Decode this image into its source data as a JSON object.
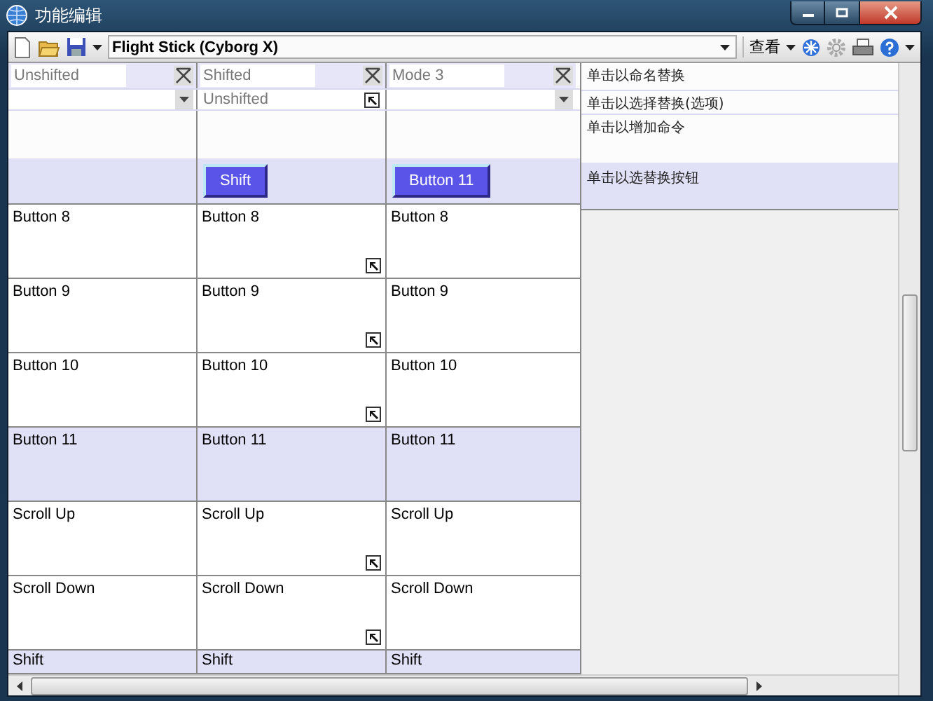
{
  "window": {
    "title": "功能编辑"
  },
  "toolbar": {
    "profile": "Flight Stick (Cyborg X)",
    "view_menu": "查看"
  },
  "modes": [
    {
      "name": "Unshifted",
      "kind": "dropdown"
    },
    {
      "name": "Shifted",
      "kind": "linked",
      "source": "Unshifted",
      "shift_button": "Shift"
    },
    {
      "name": "Mode 3",
      "kind": "dropdown",
      "shift_button": "Button 11"
    }
  ],
  "hints": [
    "单击以命名替换",
    "单击以选择替换(选项)",
    "单击以增加命令",
    "单击以选替换按钮"
  ],
  "rows": [
    {
      "highlighted": false,
      "cells": [
        {
          "label": "Button 8",
          "linked": false
        },
        {
          "label": "Button 8",
          "linked": true
        },
        {
          "label": "Button 8",
          "linked": false
        }
      ]
    },
    {
      "highlighted": false,
      "cells": [
        {
          "label": "Button 9",
          "linked": false
        },
        {
          "label": "Button 9",
          "linked": true
        },
        {
          "label": "Button 9",
          "linked": false
        }
      ]
    },
    {
      "highlighted": false,
      "cells": [
        {
          "label": "Button 10",
          "linked": false
        },
        {
          "label": "Button 10",
          "linked": true
        },
        {
          "label": "Button 10",
          "linked": false
        }
      ]
    },
    {
      "highlighted": true,
      "cells": [
        {
          "label": "Button 11",
          "linked": false
        },
        {
          "label": "Button 11",
          "linked": false
        },
        {
          "label": "Button 11",
          "linked": false
        }
      ]
    },
    {
      "highlighted": false,
      "cells": [
        {
          "label": "Scroll Up",
          "linked": false
        },
        {
          "label": "Scroll Up",
          "linked": true
        },
        {
          "label": "Scroll Up",
          "linked": false
        }
      ]
    },
    {
      "highlighted": false,
      "cells": [
        {
          "label": "Scroll Down",
          "linked": false
        },
        {
          "label": "Scroll Down",
          "linked": true
        },
        {
          "label": "Scroll Down",
          "linked": false
        }
      ]
    },
    {
      "highlighted": true,
      "cells": [
        {
          "label": "Shift",
          "linked": false
        },
        {
          "label": "Shift",
          "linked": false
        },
        {
          "label": "Shift",
          "linked": false
        }
      ]
    }
  ]
}
